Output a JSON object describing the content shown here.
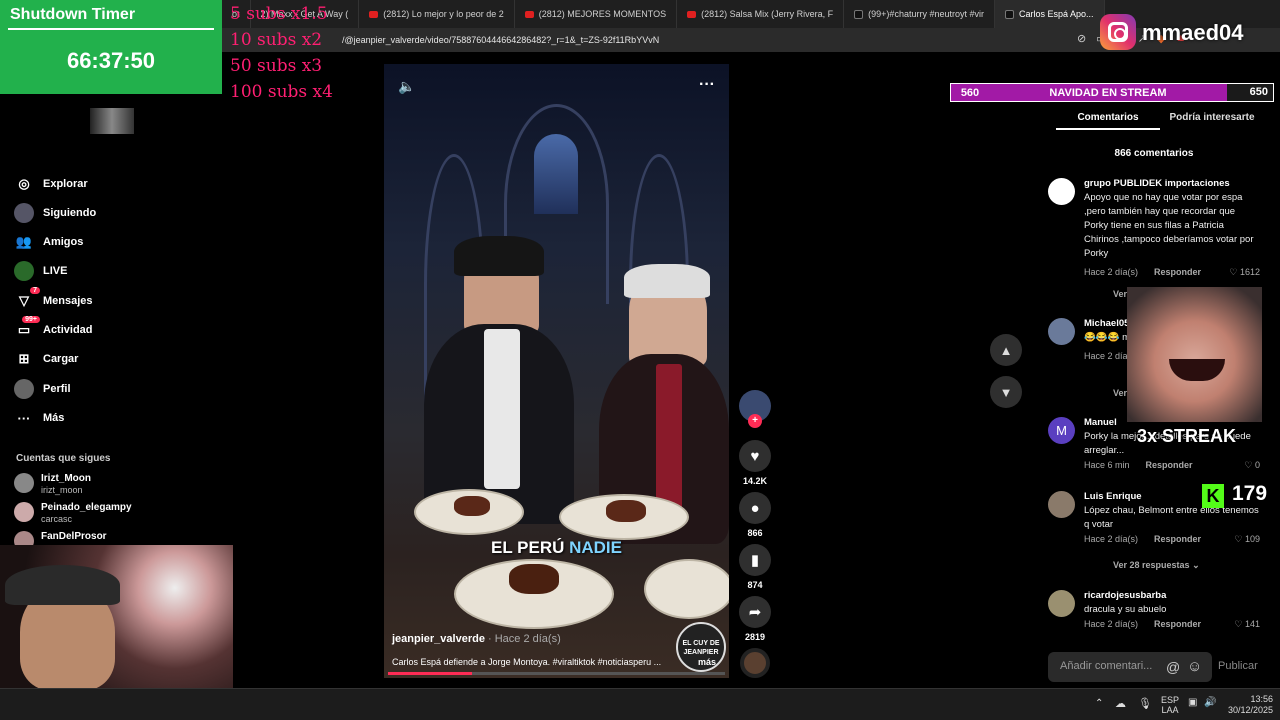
{
  "browser": {
    "tabs": [
      {
        "label": "ot",
        "icon": "none"
      },
      {
        "label": "2) Maxx - Get A Way (",
        "icon": "youtube-icon"
      },
      {
        "label": "(2812) Lo mejor y lo peor de 2",
        "icon": "youtube-icon"
      },
      {
        "label": "(2812) MEJORES MOMENTOS",
        "icon": "youtube-icon"
      },
      {
        "label": "(2812) Salsa Mix (Jerry Rivera, F",
        "icon": "youtube-icon"
      },
      {
        "label": "(99+)#chaturry #neutroyt #vir",
        "icon": "tiktok-icon"
      },
      {
        "label": "Carlos Espá Apo...",
        "icon": "tiktok-icon"
      }
    ],
    "url": "/@jeanpier_valverde/video/7588760444664286482?_r=1&_t=ZS-92f11RbYVvN"
  },
  "timer": {
    "title": "Shutdown Timer",
    "value": "66:37:50"
  },
  "subs_overlay": [
    "5 subs x1.5",
    "10 subs x2",
    "50 subs x3",
    "100 subs x4"
  ],
  "sidebar": {
    "items": [
      {
        "label": "Explorar"
      },
      {
        "label": "Siguiendo"
      },
      {
        "label": "Amigos"
      },
      {
        "label": "LIVE"
      },
      {
        "label": "Mensajes",
        "badge": "7"
      },
      {
        "label": "Actividad",
        "badge": "99+"
      },
      {
        "label": "Cargar"
      },
      {
        "label": "Perfil"
      },
      {
        "label": "Más"
      }
    ],
    "following_title": "Cuentas que sigues",
    "following": [
      {
        "name": "Irizt_Moon",
        "handle": "irizt_moon"
      },
      {
        "name": "Peinado_elegampy",
        "handle": "carcasc"
      },
      {
        "name": "FanDelProsor",
        "handle": ""
      }
    ]
  },
  "video": {
    "overlay_text_a": "EL PERÚ ",
    "overlay_text_b": "NADIE",
    "author": "jeanpier_valverde",
    "age": " · Hace 2 día(s)",
    "description": "Carlos Espá defiende a Jorge Montoya. #viraltiktok #noticiasperu ...",
    "more": "más",
    "channel_logo": "EL CUY DE JEANPIER",
    "progress": 0.25
  },
  "actions": {
    "likes": "14.2K",
    "comments": "866",
    "saves": "874",
    "shares": "2819"
  },
  "stream": {
    "ig_name": "mmaed04",
    "goal_left": "560",
    "goal_title": "NAVIDAD EN STREAM",
    "goal_right": "650",
    "streak": "3x STREAK",
    "kick_count": "179"
  },
  "comments_panel": {
    "tab_comments": "Comentarios",
    "tab_interest": "Podría interesarte",
    "count": "866 comentarios",
    "comments": [
      {
        "name": "grupo PUBLIDEK importaciones",
        "text": "Apoyo que no hay que votar por espa ,pero también hay que recordar que Porky tiene en sus filas a Patricia Chirinos ,tampoco deberíamos votar por Porky",
        "time": "Hace 2 día(s)",
        "reply": "Responder",
        "likes": "1612"
      },
      {
        "name": "Michael05",
        "text": "😂😂😂 m",
        "time": "Hace 2 día(s)",
        "reply": "",
        "likes": ""
      },
      {
        "name": "Manuel",
        "text": "Porky la mejor... detalles pero se puede arreglar...",
        "time": "Hace 6 min",
        "reply": "Responder",
        "likes": "0",
        "initial": "M"
      },
      {
        "name": "Luis Enrique",
        "text": "López chau, Belmont entre ellos tenemos q votar",
        "time": "Hace 2 día(s)",
        "reply": "Responder",
        "likes": "109"
      },
      {
        "name": "ricardojesusbarba",
        "text": "dracula y su abuelo",
        "time": "Hace 2 día(s)",
        "reply": "Responder",
        "likes": "141"
      }
    ],
    "view_more_1": "Ver",
    "view_more_2": "Ver",
    "view_replies": "Ver 28 respuestas",
    "add_placeholder": "Añadir comentari...",
    "publish": "Publicar"
  },
  "taskbar": {
    "lang": "ESP",
    "lang2": "LAA",
    "time": "13:56",
    "date": "30/12/2025"
  }
}
